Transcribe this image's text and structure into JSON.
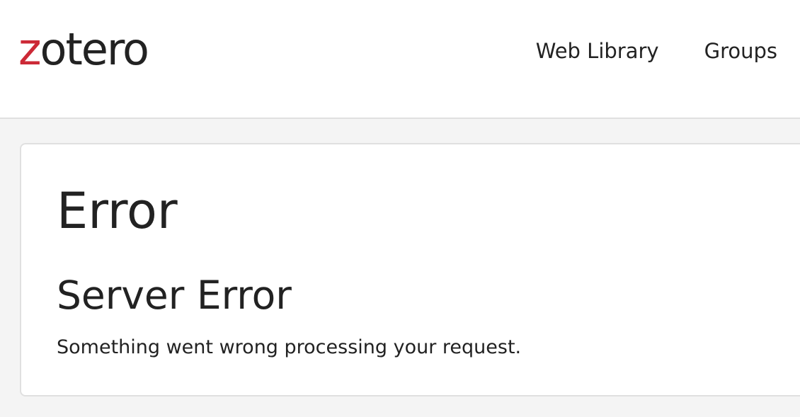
{
  "header": {
    "logo": {
      "first_letter": "z",
      "rest": "otero",
      "accent_color": "#cc2936"
    },
    "nav": [
      {
        "label": "Web Library"
      },
      {
        "label": "Groups"
      }
    ]
  },
  "main": {
    "title": "Error",
    "subtitle": "Server Error",
    "message": "Something went wrong processing your request."
  },
  "colors": {
    "background": "#f4f4f4",
    "card": "#ffffff",
    "border": "#e0e0e0",
    "text": "#222222"
  }
}
